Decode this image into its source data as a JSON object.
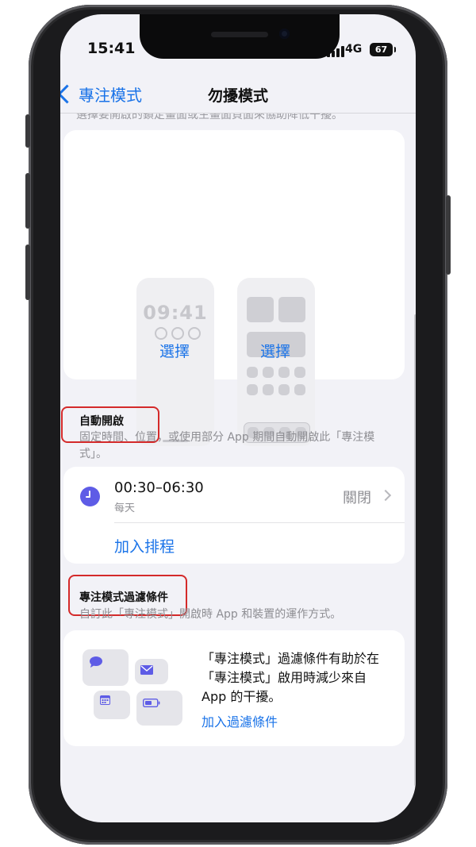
{
  "status_bar": {
    "time": "15:41",
    "network": "4G",
    "battery": "67"
  },
  "nav": {
    "back_label": "專注模式",
    "title": "勿擾模式"
  },
  "customize": {
    "hint": "選擇要開啟的鎖定畫面或主畫面頁面來協助降低干擾。",
    "lock_preview_time": "09:41",
    "lock_choose": "選擇",
    "home_choose": "選擇"
  },
  "auto_on": {
    "header": "自動開啟",
    "description": "固定時間、位置，或使用部分 App 期間自動開啟此「專注模式」。"
  },
  "schedule": {
    "time_range": "00:30–06:30",
    "days": "每天",
    "state": "關閉",
    "add_label": "加入排程"
  },
  "filters": {
    "header": "專注模式過濾條件",
    "description": "自訂此「專注模式」開啟時 App 和裝置的運作方式。",
    "body": "「專注模式」過濾條件有助於在「專注模式」啟用時減少來自 App 的干擾。",
    "add_label": "加入過濾條件"
  },
  "colors": {
    "accent": "#1a73e8",
    "highlight_box": "#d42a2a",
    "clock_icon": "#5e5ce6"
  }
}
